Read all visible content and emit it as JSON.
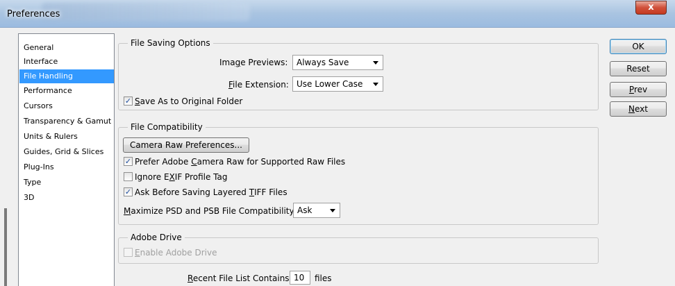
{
  "window": {
    "title": "Preferences",
    "close_label": "x"
  },
  "sidebar": {
    "items": [
      {
        "label": "General"
      },
      {
        "label": "Interface"
      },
      {
        "label": "File Handling",
        "selected": true
      },
      {
        "label": "Performance"
      },
      {
        "label": "Cursors"
      },
      {
        "label": "Transparency & Gamut"
      },
      {
        "label": "Units & Rulers"
      },
      {
        "label": "Guides, Grid & Slices"
      },
      {
        "label": "Plug-Ins"
      },
      {
        "label": "Type"
      },
      {
        "label": "3D"
      }
    ]
  },
  "file_saving": {
    "legend": "File Saving Options",
    "image_previews": {
      "pre": "Ima",
      "mnemonic": "g",
      "post": "e Previews:",
      "value": "Always Save"
    },
    "file_extension": {
      "pre": "",
      "mnemonic": "F",
      "post": "ile Extension:",
      "value": "Use Lower Case"
    },
    "save_as_original": {
      "pre": "",
      "mnemonic": "S",
      "post": "ave As to Original Folder",
      "checked": true
    }
  },
  "file_compat": {
    "legend": "File Compatibility",
    "camera_raw_button": "Camera Raw Preferences...",
    "prefer_camera_raw": {
      "pre": "Prefer Adobe ",
      "mnemonic": "C",
      "post": "amera Raw for Supported Raw Files",
      "checked": true
    },
    "ignore_exif": {
      "pre": "Ignore E",
      "mnemonic": "X",
      "post": "IF Profile Tag",
      "checked": false
    },
    "ask_tiff": {
      "pre": "Ask Before Saving Layered ",
      "mnemonic": "T",
      "post": "IFF Files",
      "checked": true
    },
    "maximize": {
      "pre": "",
      "mnemonic": "M",
      "post": "aximize PSD and PSB File Compatibility:",
      "value": "Ask"
    }
  },
  "adobe_drive": {
    "legend": "Adobe Drive",
    "enable": {
      "pre": "",
      "mnemonic": "E",
      "post": "nable Adobe Drive",
      "checked": false,
      "disabled": true
    }
  },
  "recent": {
    "pre": "",
    "mnemonic": "R",
    "post": "ecent File List Contains:",
    "value": "10",
    "suffix": "files"
  },
  "buttons": {
    "ok": "OK",
    "reset": "Reset",
    "prev": {
      "pre": "",
      "mnemonic": "P",
      "post": "rev"
    },
    "next": {
      "pre": "",
      "mnemonic": "N",
      "post": "ext"
    }
  },
  "colors": {
    "selection": "#3399ff",
    "titlebar": "#a9c4e1",
    "close": "#c53a20"
  }
}
